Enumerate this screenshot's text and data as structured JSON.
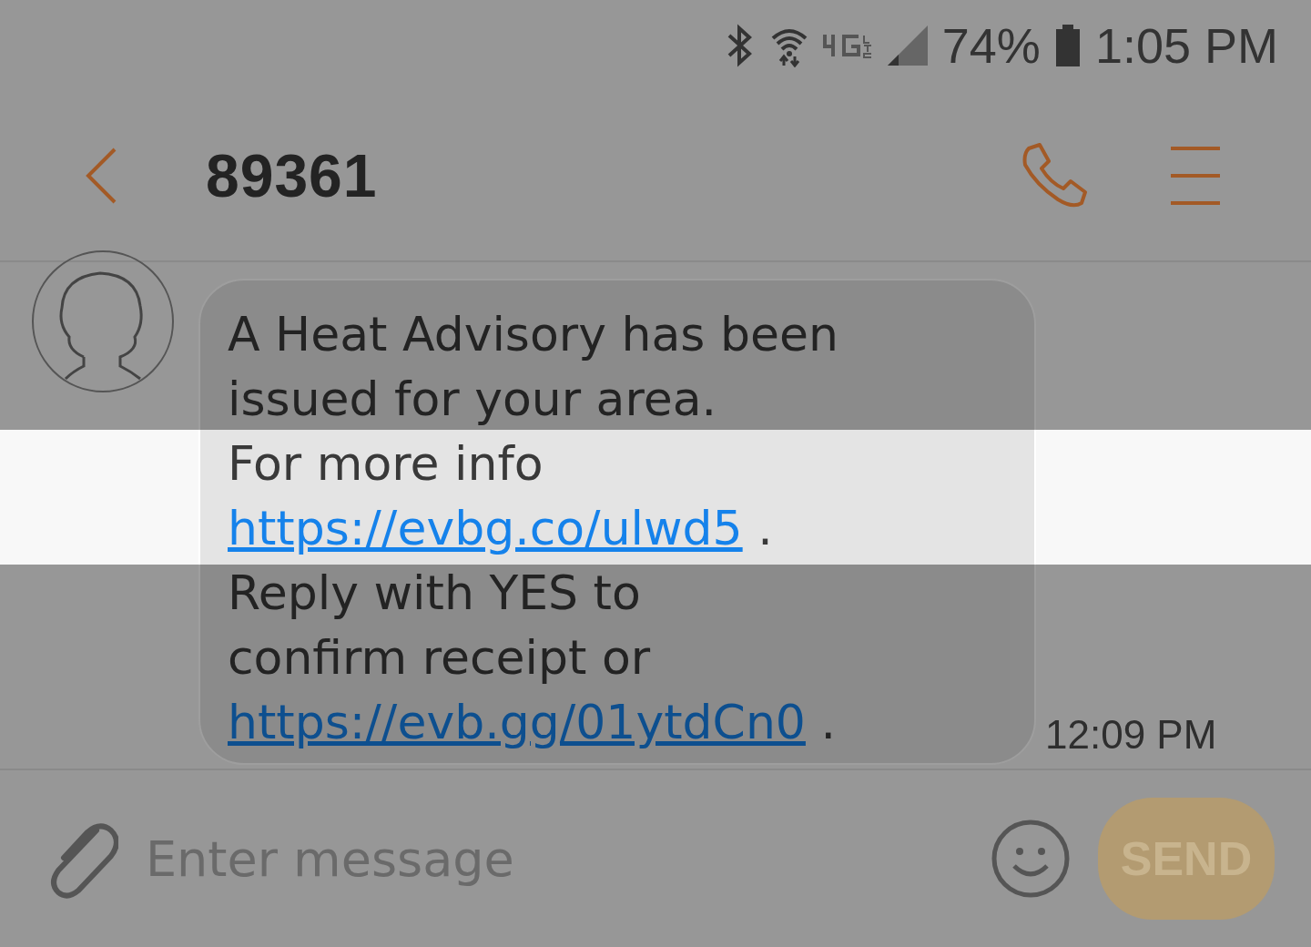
{
  "status_bar": {
    "battery": "74%",
    "time": "1:05 PM"
  },
  "header": {
    "title": "89361"
  },
  "message": {
    "lines": [
      {
        "parts": [
          {
            "kind": "text",
            "text": "A Heat Advisory has been"
          }
        ]
      },
      {
        "parts": [
          {
            "kind": "text",
            "text": "issued for your area."
          }
        ]
      },
      {
        "parts": [
          {
            "kind": "text",
            "text": "For more info"
          }
        ]
      },
      {
        "parts": [
          {
            "kind": "link",
            "text": "https://evbg.co/ulwd5"
          },
          {
            "kind": "text",
            "text": " ."
          }
        ]
      },
      {
        "parts": [
          {
            "kind": "text",
            "text": "Reply with YES to"
          }
        ]
      },
      {
        "parts": [
          {
            "kind": "text",
            "text": "confirm receipt or"
          }
        ]
      },
      {
        "parts": [
          {
            "kind": "link",
            "text": "https://evb.gg/01ytdCn0"
          },
          {
            "kind": "text",
            "text": " ."
          }
        ]
      }
    ],
    "time": "12:09 PM"
  },
  "composer": {
    "placeholder": "Enter message",
    "send_button": {
      "label": "SEND",
      "disabled": true
    }
  }
}
